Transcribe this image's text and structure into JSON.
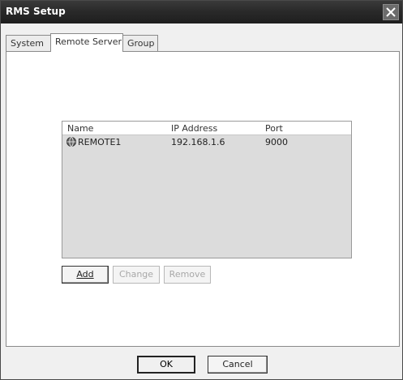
{
  "window": {
    "title": "RMS Setup"
  },
  "tabs": [
    {
      "label": "System",
      "active": false
    },
    {
      "label": "Remote Server",
      "active": true
    },
    {
      "label": "Group",
      "active": false
    }
  ],
  "server_list": {
    "columns": [
      "Name",
      "IP Address",
      "Port"
    ],
    "rows": [
      {
        "name": "REMOTE1",
        "ip": "192.168.1.6",
        "port": "9000",
        "icon": "server-icon"
      }
    ]
  },
  "actions": {
    "add": "Add",
    "change": "Change",
    "remove": "Remove"
  },
  "footer": {
    "ok": "OK",
    "cancel": "Cancel"
  },
  "colors": {
    "titlebar": "#2a2a2a",
    "list_background": "#dcdcdc",
    "panel": "#ffffff"
  }
}
